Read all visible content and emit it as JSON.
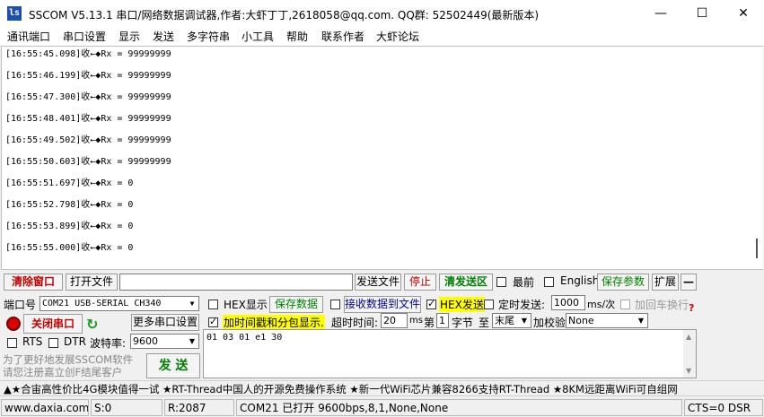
{
  "window": {
    "title": "SSCOM V5.13.1 串口/网络数据调试器,作者:大虾丁丁,2618058@qq.com. QQ群: 52502449(最新版本)",
    "icon_text": "ls"
  },
  "menu": [
    "通讯端口",
    "串口设置",
    "显示",
    "发送",
    "多字符串",
    "小工具",
    "帮助",
    "联系作者",
    "大虾论坛"
  ],
  "log": [
    "[16:55:45.098]收←◆Rx = 99999999",
    "[16:55:46.199]收←◆Rx = 99999999",
    "[16:55:47.300]收←◆Rx = 99999999",
    "[16:55:48.401]收←◆Rx = 99999999",
    "[16:55:49.502]收←◆Rx = 99999999",
    "[16:55:50.603]收←◆Rx = 99999999",
    "[16:55:51.697]收←◆Rx = 0",
    "[16:55:52.798]收←◆Rx = 0",
    "[16:55:53.899]收←◆Rx = 0",
    "[16:55:55.000]收←◆Rx = 0"
  ],
  "toolbar": {
    "clear_window": "清除窗口",
    "open_file": "打开文件",
    "file_path": "",
    "send_file": "发送文件",
    "stop": "停止",
    "clear_send": "清发送区",
    "latest": "最前",
    "english": "English",
    "save_params": "保存参数",
    "expand": "扩展",
    "collapse": "—"
  },
  "port": {
    "label": "端口号",
    "value": "COM21 USB-SERIAL CH340",
    "close_port": "关闭串口",
    "more_settings": "更多串口设置",
    "rts": "RTS",
    "dtr": "DTR",
    "baud_label": "波特率:",
    "baud_value": "9600"
  },
  "options": {
    "hex_display": "HEX显示",
    "save_data": "保存数据",
    "recv_to_file": "接收数据到文件",
    "hex_send": "HEX发送",
    "timed_send": "定时发送:",
    "interval": "1000",
    "interval_unit": "ms/次",
    "add_newline": "加回车换行",
    "timestamp": "加时间戳和分包显示.",
    "timeout_label": "超时时间:",
    "timeout_value": "20",
    "timeout_unit": "ms",
    "byte_prefix": "第",
    "byte_from": "1",
    "byte_unit": "字节",
    "to": "至",
    "byte_to": "末尾",
    "checksum_label": "加校验",
    "checksum_value": "None"
  },
  "send_text": "01 03 01 e1 30",
  "promo": {
    "line1": "为了更好地发展SSCOM软件",
    "line2": "请您注册嘉立创F结尾客户",
    "send_button": "发 送"
  },
  "ticker": "▲★合宙高性价比4G模块值得一试 ★RT-Thread中国人的开源免费操作系统 ★新一代WiFi芯片兼容8266支持RT-Thread ★8KM远距离WiFi可自组网",
  "status": {
    "website": "www.daxia.com",
    "sent": "S:0",
    "received": "R:2087",
    "port_state": "COM21 已打开  9600bps,8,1,None,None",
    "cts": "CTS=0 DSR"
  }
}
